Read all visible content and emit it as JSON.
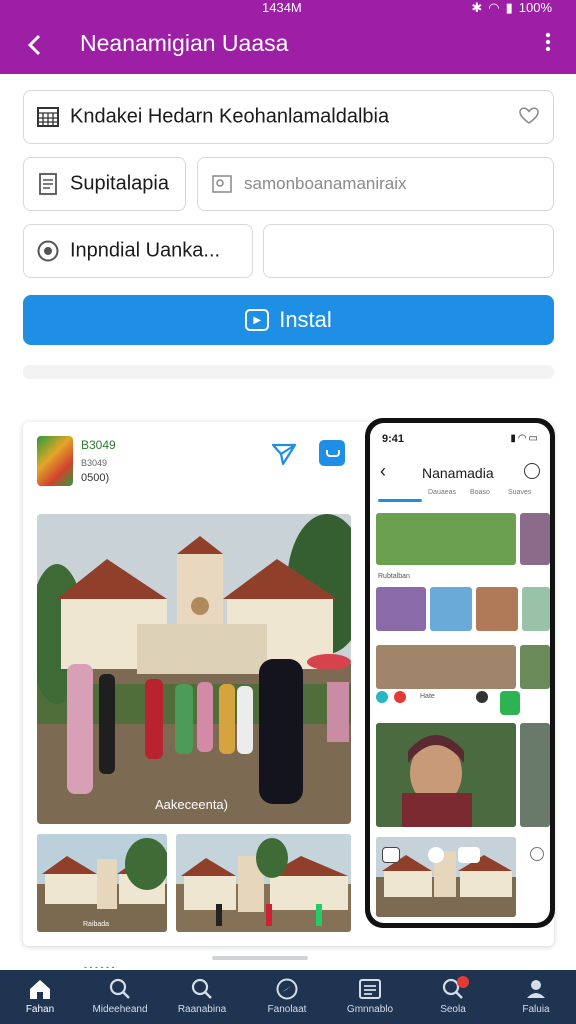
{
  "status": {
    "time": "1434M",
    "battery": "100%",
    "icons": [
      "bluetooth-icon",
      "wifi-icon",
      "signal-icon",
      "battery-icon"
    ]
  },
  "app_bar": {
    "title": "Neanamigian Uaasa"
  },
  "form": {
    "field1_value": "Kndakei Hedarn Keohanlamaldalbia",
    "field2_value": "Supitalapia",
    "field3_placeholder": "samonboanamaniraix",
    "field4_value": "Inpndial Uanka...",
    "field5_placeholder": ""
  },
  "install": {
    "label": "Instal"
  },
  "card": {
    "meta1": "B3049",
    "meta2": "B3049",
    "meta3": "0500)",
    "main_caption": "Aakeceenta)",
    "thumb_caption": "Raibada"
  },
  "phone": {
    "time": "9:41",
    "title": "Nanamadia",
    "tabs": [
      "Dauaeas",
      "Boaso",
      "Suaves"
    ],
    "label1": "Rubtalban",
    "label2": "Hate"
  },
  "nav": [
    {
      "label": "Fahan",
      "icon": "home-icon"
    },
    {
      "label": "Mideeheand",
      "icon": "search-icon"
    },
    {
      "label": "Raanabina",
      "icon": "search-icon"
    },
    {
      "label": "Fanolaat",
      "icon": "compass-icon"
    },
    {
      "label": "Gmnnablo",
      "icon": "list-icon"
    },
    {
      "label": "Seola",
      "icon": "search-icon"
    },
    {
      "label": "Faluia",
      "icon": "profile-icon"
    }
  ],
  "colors": {
    "app_bar": "#9c1fa6",
    "accent": "#1f8fe5",
    "nav_bg": "#1f3451"
  }
}
